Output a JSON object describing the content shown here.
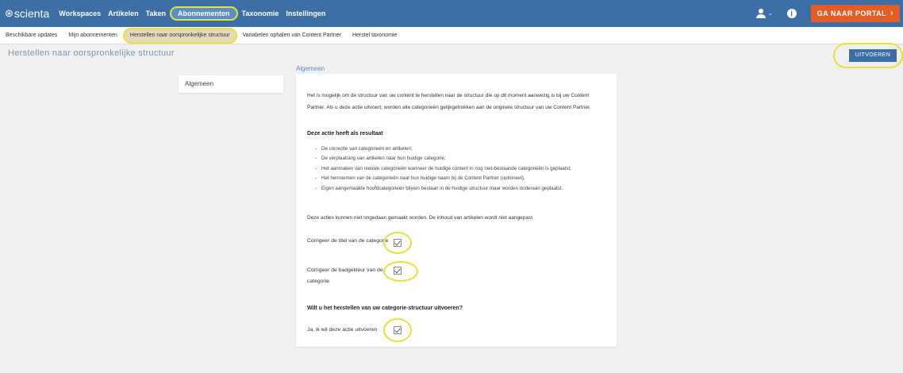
{
  "topnav": {
    "logo": "scienta",
    "items": [
      "Workspaces",
      "Artikelen",
      "Taken",
      "Abonnementen",
      "Taxonomie",
      "Instellingen"
    ],
    "active_item": "Abonnementen",
    "user_chevron": "⌄",
    "info_label": "i",
    "portal_button": "GA NAAR PORTAL",
    "portal_chevron": "›"
  },
  "subnav": {
    "items": [
      "Beschikbare updates",
      "Mijn abonnementen",
      "Herstellen naar oorspronkelijke structuur",
      "Variabelen ophalen van Content Partner",
      "Herstel taxonomie"
    ],
    "active_item": "Herstellen naar oorspronkelijke structuur"
  },
  "page": {
    "title": "Herstellen naar oorspronkelijke structuur",
    "run_button": "UITVOEREN"
  },
  "section_menu": {
    "items": [
      "Algemeen"
    ]
  },
  "content": {
    "section_heading": "Algemeen",
    "intro": "Het is mogelijk om de structuur van uw content te herstellen naar de structuur die op dit moment aanwezig is bij uw Content Partner. Als u deze actie uitvoert, worden alle categorieën gelijkgetrokken aan de originele structuur van uw Content Partner.",
    "result_heading": "Deze actie heeft als resultaat",
    "results": [
      "De correctie van categorieën en artikelen;",
      "De verplaatsing van artikelen naar hun huidige categorie;",
      "Het aanmaken van nieuwe categorieën wanneer de huidige content in nog niet-bestaande categorieën is geplaatst;",
      "Het hernoemen van de categorieën naar hun huidige naam bij de Content Partner (optioneel).",
      "Eigen aangemaakte hoofdcategorieën blijven bestaan in de huidige structuur maar worden onderaan geplaatst."
    ],
    "undo_note": "Deze acties kunnen niet ongedaan gemaakt worden. De inhoud van artikelen wordt niet aangepast.",
    "options": [
      {
        "label": "Corrigeer de titel van de categorie",
        "checked": true
      },
      {
        "label": "Corrigeer de badgekleur van de categorie",
        "checked": true
      }
    ],
    "confirm_heading": "Wilt u het herstellen van uw categorie-structuur uitvoeren?",
    "confirm": {
      "label": "Ja, ik wil deze actie uitvoeren",
      "checked": true
    }
  },
  "colors": {
    "nav_bar": "#3b6fa6",
    "portal_button": "#e35d27",
    "highlight": "#e7e13c"
  }
}
